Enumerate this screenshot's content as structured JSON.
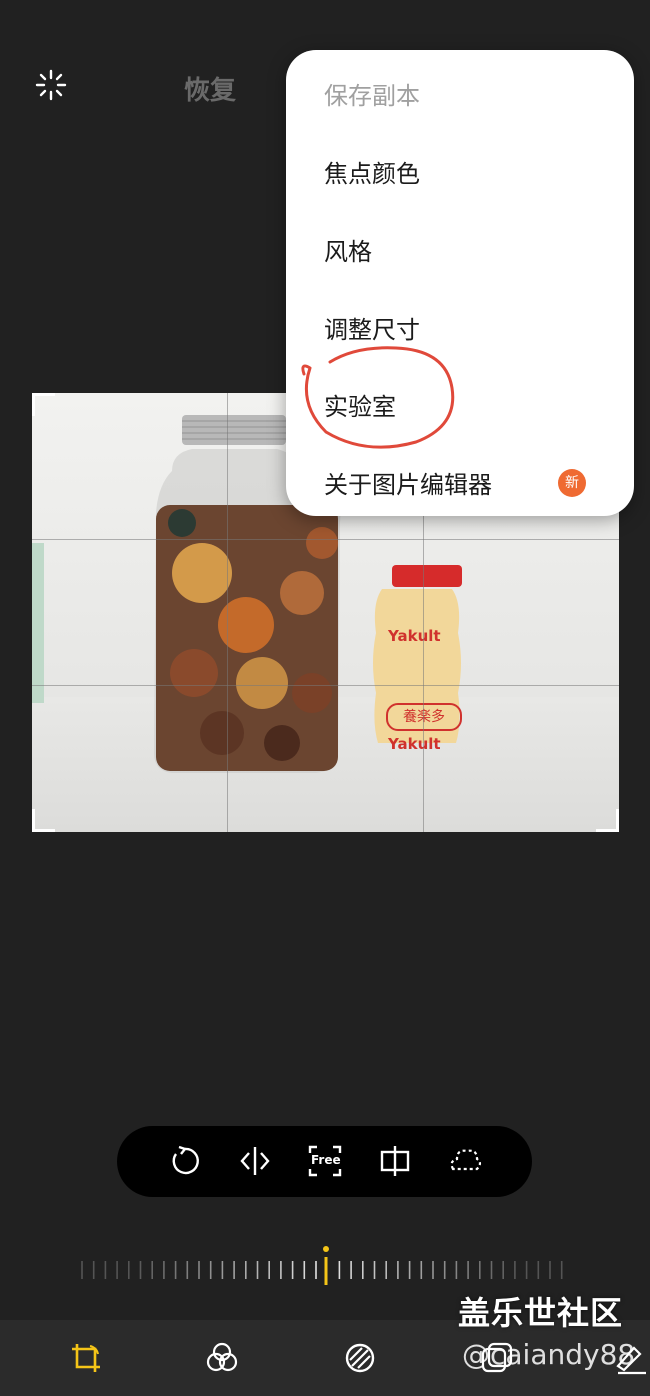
{
  "header": {
    "auto_icon": "auto-enhance-icon",
    "restore_label": "恢复"
  },
  "menu": {
    "items": [
      {
        "label": "保存副本",
        "disabled": true
      },
      {
        "label": "焦点颜色"
      },
      {
        "label": "风格"
      },
      {
        "label": "调整尺寸"
      },
      {
        "label": "实验室"
      },
      {
        "label": "关于图片编辑器"
      }
    ],
    "new_badge": "新"
  },
  "photo": {
    "jar_label": "",
    "bottle_label_1": "Yakult",
    "bottle_label_2": "養楽多",
    "bottle_label_3": "Yakult"
  },
  "toolbar": {
    "icons": [
      "rotate-icon",
      "flip-icon",
      "free-aspect-icon",
      "straighten-icon",
      "lasso-icon"
    ],
    "free_label": "Free"
  },
  "ruler": {
    "value": 0
  },
  "bottom_nav": {
    "icons": [
      "crop-transform-icon",
      "filters-icon",
      "adjust-icon",
      "sticker-icon",
      "draw-icon"
    ]
  },
  "watermark": {
    "title": "盖乐世社区",
    "user": "@caiandy88"
  },
  "colors": {
    "accent": "#f5c518",
    "badge": "#ef6a32",
    "annotation": "#e0493a"
  }
}
